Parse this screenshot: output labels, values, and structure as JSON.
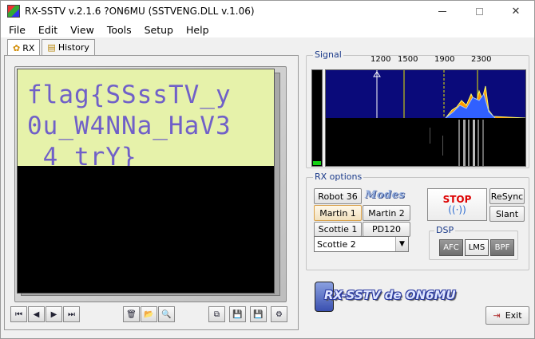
{
  "window": {
    "title": "RX-SSTV v.2.1.6 ?ON6MU (SSTVENG.DLL v.1.06)",
    "minimize_icon": "minimize-icon",
    "maximize_icon": "maximize-icon",
    "close_glyph": "✕"
  },
  "menu": [
    "File",
    "Edit",
    "View",
    "Tools",
    "Setup",
    "Help"
  ],
  "tabs": [
    {
      "label": "RX",
      "icon": "gear-icon",
      "active": true
    },
    {
      "label": "History",
      "icon": "history-icon",
      "active": false
    }
  ],
  "image": {
    "lines": [
      "flag{SSssTV_y",
      "0u_W4NNa_HaV3",
      "_4_trY}"
    ],
    "text_color": "#7060c8",
    "bg_color": "#e6f2aa"
  },
  "image_controls": {
    "nav": [
      {
        "name": "first-button",
        "glyph": "⏮"
      },
      {
        "name": "prev-button",
        "glyph": "◀"
      },
      {
        "name": "next-button",
        "glyph": "▶"
      },
      {
        "name": "last-button",
        "glyph": "⏭"
      }
    ],
    "tools": [
      {
        "name": "delete-button",
        "glyph": "🗑"
      },
      {
        "name": "open-folder-button",
        "glyph": "📂"
      },
      {
        "name": "zoom-button",
        "glyph": "🔍"
      }
    ],
    "actions": [
      {
        "name": "copy-button",
        "glyph": "⧉"
      },
      {
        "name": "save-button",
        "glyph": "💾"
      },
      {
        "name": "save-as-button",
        "glyph": "💾"
      },
      {
        "name": "settings-button",
        "glyph": "⚙"
      }
    ]
  },
  "signal": {
    "label": "Signal",
    "freqs": [
      "1200",
      "1500",
      "1900",
      "2300"
    ],
    "level": 0.04
  },
  "rx_options": {
    "label": "RX options",
    "modes_label": "Modes",
    "modes": [
      "Robot 36",
      "Martin 1",
      "Martin 2",
      "Scottie 1",
      "PD120"
    ],
    "selected_mode": "Martin 1",
    "select_value": "Scottie 2",
    "stop_label": "STOP",
    "resync_label": "ReSync",
    "slant_label": "Slant",
    "dsp_label": "DSP",
    "dsp_buttons": [
      {
        "label": "AFC",
        "on": false
      },
      {
        "label": "LMS",
        "on": true
      },
      {
        "label": "BPF",
        "on": false
      }
    ]
  },
  "logo_text": "RX-SSTV de ON6MU",
  "exit_label": "Exit"
}
